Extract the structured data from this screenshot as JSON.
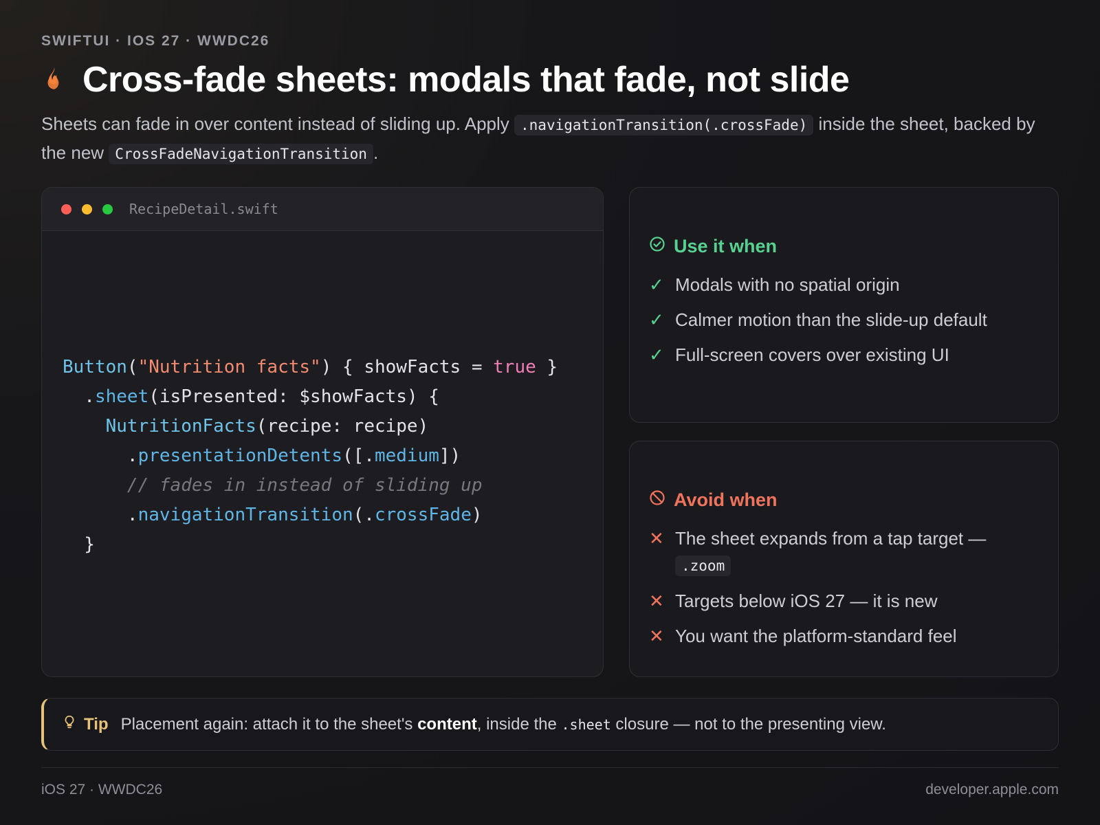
{
  "eyebrow": "SWIFTUI · IOS 27 · WWDC26",
  "title": "Cross-fade sheets: modals that fade, not slide",
  "title_icon": "flame-icon",
  "subtitle": {
    "part1": "Sheets can fade in over content instead of sliding up. Apply ",
    "code1": ".navigationTransition(.crossFade)",
    "part2": " inside the sheet, backed by the new ",
    "code2": "CrossFadeNavigationTransition",
    "part3": "."
  },
  "editor": {
    "filename": "RecipeDetail.swift",
    "lines": [
      [
        [
          "type",
          "Button"
        ],
        [
          "plain",
          "("
        ],
        [
          "str",
          "\"Nutrition facts\""
        ],
        [
          "plain",
          ") { showFacts = "
        ],
        [
          "kw",
          "true"
        ],
        [
          "plain",
          " }"
        ]
      ],
      [
        [
          "plain",
          "  ."
        ],
        [
          "fn",
          "sheet"
        ],
        [
          "plain",
          "(isPresented: $showFacts) {"
        ]
      ],
      [
        [
          "plain",
          "    "
        ],
        [
          "type",
          "NutritionFacts"
        ],
        [
          "plain",
          "(recipe: recipe)"
        ]
      ],
      [
        [
          "plain",
          "      ."
        ],
        [
          "fn",
          "presentationDetents"
        ],
        [
          "plain",
          "([."
        ],
        [
          "fn",
          "medium"
        ],
        [
          "plain",
          "])"
        ]
      ],
      [
        [
          "plain",
          "      "
        ],
        [
          "cmt",
          "// fades in instead of sliding up"
        ]
      ],
      [
        [
          "plain",
          "      ."
        ],
        [
          "fn",
          "navigationTransition"
        ],
        [
          "plain",
          "(."
        ],
        [
          "fn",
          "crossFade"
        ],
        [
          "plain",
          ")"
        ]
      ],
      [
        [
          "plain",
          "  }"
        ]
      ]
    ]
  },
  "use_card": {
    "heading": "Use it when",
    "items": [
      "Modals with no spatial origin",
      "Calmer motion than the slide-up default",
      "Full-screen covers over existing UI"
    ]
  },
  "avoid_card": {
    "heading": "Avoid when",
    "items": [
      {
        "text": "The sheet expands from a tap target — ",
        "code": ".zoom"
      },
      {
        "text": "Targets below iOS 27 — it is new"
      },
      {
        "text": "You want the platform-standard feel"
      }
    ]
  },
  "tip": {
    "label": "Tip",
    "part1": "Placement again: attach it to the sheet's ",
    "bold": "content",
    "part2": ", inside the ",
    "code": ".sheet",
    "part3": " closure — not to the presenting view."
  },
  "footer": {
    "left": "iOS 27 · WWDC26",
    "right": "developer.apple.com"
  },
  "colors": {
    "accent_green": "#57d18f",
    "accent_red": "#f0745d",
    "tip_gold": "#e6c27a"
  }
}
